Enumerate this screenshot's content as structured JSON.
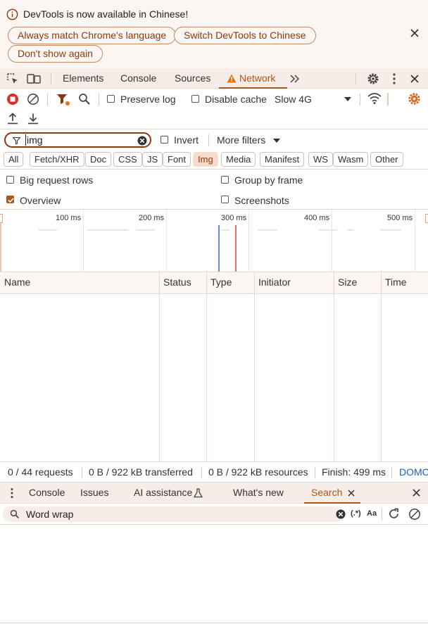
{
  "colors": {
    "accent": "#b25318",
    "accent_dark": "#8b3a0e",
    "record_red": "#d93025",
    "panel_bg": "#fcf6f3",
    "blue_marker": "#6a86d6",
    "red_marker": "#e07070"
  },
  "infobar": {
    "message": "DevTools is now available in Chinese!",
    "buttons": [
      "Always match Chrome's language",
      "Switch DevTools to Chinese",
      "Don't show again"
    ],
    "icons": {
      "info": "info-icon",
      "close": "close-icon"
    }
  },
  "main_tabs": {
    "items": [
      "Elements",
      "Console",
      "Sources",
      "Network"
    ],
    "active": "Network",
    "network_warning_icon": "warning-triangle-icon"
  },
  "toolbar": {
    "preserve_log": "Preserve log",
    "disable_cache": "Disable cache",
    "throttling": "Slow 4G"
  },
  "filter": {
    "value": "img",
    "invert": "Invert",
    "more_filters": "More filters"
  },
  "type_filters": [
    "All",
    "Fetch/XHR",
    "Doc",
    "CSS",
    "JS",
    "Font",
    "Img",
    "Media",
    "Manifest",
    "WS",
    "Wasm",
    "Other"
  ],
  "active_type": "Img",
  "settings": {
    "big_request_rows": "Big request rows",
    "group_by_frame": "Group by frame",
    "overview": "Overview",
    "screenshots": "Screenshots"
  },
  "overview": {
    "ticks": [
      "100 ms",
      "200 ms",
      "300 ms",
      "400 ms",
      "500 ms"
    ]
  },
  "table": {
    "columns": [
      "Name",
      "Status",
      "Type",
      "Initiator",
      "Size",
      "Time"
    ]
  },
  "status": {
    "requests": "0 / 44 requests",
    "transferred": "0 B / 922 kB transferred",
    "resources": "0 B / 922 kB resources",
    "finish": "Finish: 499 ms",
    "domcontent": "DOMC"
  },
  "drawer": {
    "tabs": [
      "Console",
      "Issues",
      "AI assistance",
      "What's new",
      "Search"
    ],
    "active": "Search",
    "search_value": "Word wrap",
    "regex_label": "(.*)",
    "case_label": "Aa"
  }
}
